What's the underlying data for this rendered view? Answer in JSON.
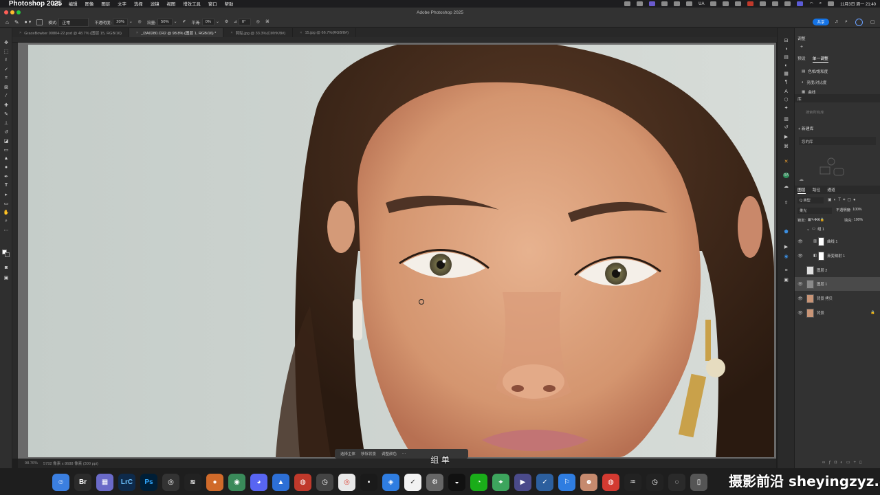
{
  "menubar": {
    "app_name": "Photoshop 2025",
    "items": [
      "文件",
      "编辑",
      "图像",
      "图层",
      "文字",
      "选择",
      "滤镜",
      "视图",
      "增效工具",
      "窗口",
      "帮助"
    ],
    "clock": "11月3日 周一 21:40",
    "tray_ua": "UA"
  },
  "window": {
    "title": "Adobe Photoshop 2025"
  },
  "options": {
    "mode_label": "模式:",
    "mode_value": "正常",
    "opacity_label": "不透明度:",
    "opacity_value": "20%",
    "flow_label": "流量:",
    "flow_value": "50%",
    "smooth_label": "平滑:",
    "smooth_value": "0%",
    "angle_value": "0°",
    "share_label": "共享"
  },
  "tabs": [
    {
      "label": "GraceBowker 00804-22.psd @ 48.7% (图层 15, RGB/16)"
    },
    {
      "label": "_I3A0280.CR2 @ 98.8% (图层 1, RGB/16) *"
    },
    {
      "label": "剪贴.jpg @ 33.3%(CMYK/8#)"
    },
    {
      "label": "15.jpg @ 66.7%(RGB/8#)"
    }
  ],
  "status": {
    "zoom": "98.76%",
    "doc": "5792 像素 x 8688 像素 (300 ppi)"
  },
  "contextbar": {
    "select_subject": "选择主体",
    "remove_bg": "移除背景",
    "adjust": "调整颜色"
  },
  "panels": {
    "adjust_header": "调整",
    "adjust_tabs": [
      "预设",
      "单一调整"
    ],
    "adjust_items": [
      "色相/饱和度",
      "亮度/对比度",
      "曲线"
    ],
    "library_header": "库",
    "library_search": "搜索所有库",
    "new_library": "新建库",
    "library_name": "您的库",
    "layers_tabs": [
      "图层",
      "路径",
      "通道"
    ],
    "kind_label": "Q 类型",
    "blend_mode": "柔光",
    "opacity_label": "不透明度:",
    "opacity_value": "100%",
    "lock_label": "锁定:",
    "fill_label": "填充:",
    "fill_value": "100%",
    "layers": [
      {
        "name": "组 1",
        "type": "group"
      },
      {
        "name": "曲线 1",
        "type": "adjust"
      },
      {
        "name": "渐变映射 1",
        "type": "adjust"
      },
      {
        "name": "图层 2",
        "type": "pixel"
      },
      {
        "name": "图层 1",
        "type": "pixel",
        "selected": true
      },
      {
        "name": "背景 拷贝",
        "type": "photo"
      },
      {
        "name": "背景",
        "type": "photo"
      }
    ]
  },
  "dock": {
    "apps": [
      "Finder",
      "Br",
      "Launchpad",
      "LrC",
      "Ps",
      "Chrome",
      "AE",
      "Screen",
      "Discord",
      "Mail",
      "Music",
      "Clock",
      "Chrome2",
      "App",
      "Safari",
      "Notes",
      "Settings",
      "QQ",
      "WeChat",
      "Maps",
      "Tools",
      "Store",
      "Folder",
      "Photos",
      "Gallery",
      "Netease",
      "Activity",
      "Utility",
      "Disk",
      "Trash"
    ]
  },
  "overlay": {
    "subtitle": "组 单",
    "watermark": "摄影前沿 sheyingzyz.com"
  }
}
